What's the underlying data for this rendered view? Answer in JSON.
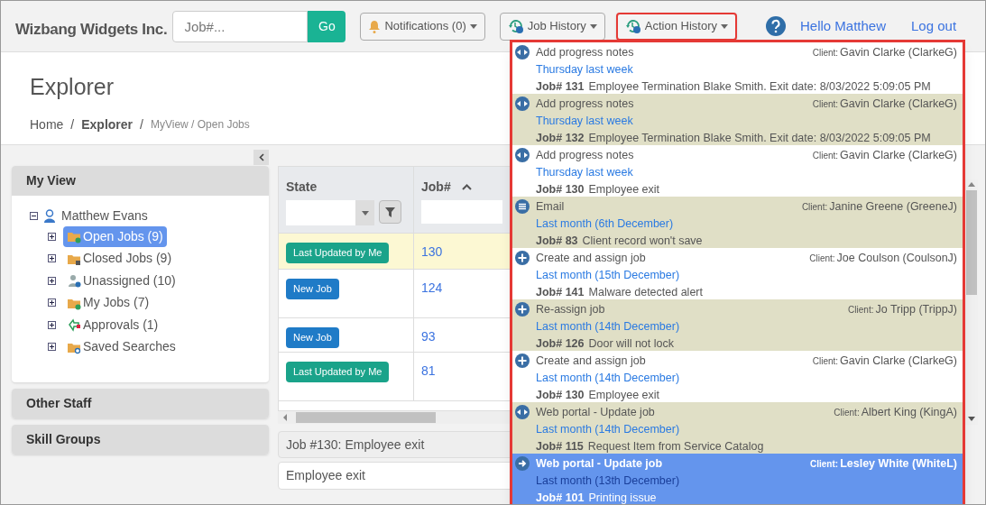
{
  "header": {
    "brand": "Wizbang Widgets Inc.",
    "search": {
      "placeholder": "Job#...",
      "button": "Go"
    },
    "notifications": "Notifications (0)",
    "job_history": "Job History",
    "action_history": {
      "label": "Action History",
      "expanded": true
    },
    "greeting": "Hello Matthew",
    "logout": "Log out"
  },
  "page": {
    "title": "Explorer",
    "breadcrumb": [
      "Home",
      "/",
      "Explorer",
      "/",
      "MyView / Open Jobs"
    ]
  },
  "sidebar": {
    "sections": [
      {
        "title": "My View",
        "tree": {
          "label": "Matthew Evans",
          "expanded": true,
          "children": [
            {
              "label": "Open Jobs (9)",
              "kind": "folder_user",
              "selected": true
            },
            {
              "label": "Closed Jobs (9)",
              "kind": "folder_closed",
              "selected": false
            },
            {
              "label": "Unassigned (10)",
              "kind": "user_question",
              "selected": false
            },
            {
              "label": "My Jobs (7)",
              "kind": "folder_user",
              "selected": false
            },
            {
              "label": "Approvals (1)",
              "kind": "approvals",
              "selected": false
            },
            {
              "label": "Saved Searches",
              "kind": "folder_search",
              "selected": false
            }
          ]
        }
      },
      {
        "title": "Other Staff"
      },
      {
        "title": "Skill Groups"
      }
    ]
  },
  "table": {
    "columns": [
      "State",
      "Job#"
    ],
    "rows": [
      {
        "state": "Last Updated by Me",
        "color": "#1aa38a",
        "job": "130",
        "selected": true
      },
      {
        "state": "New Job",
        "color": "#1f7bc7",
        "job": "124",
        "selected": false
      },
      {
        "state": "New Job",
        "color": "#1f7bc7",
        "job": "93",
        "selected": false
      },
      {
        "state": "Last Updated by Me",
        "color": "#1aa38a",
        "job": "81",
        "selected": false
      }
    ]
  },
  "detail": {
    "heading": "Job #130: Employee exit",
    "summary": "Employee exit"
  },
  "action_history_menu": [
    {
      "kind": "notes",
      "action": "Add progress notes",
      "client_label": "Client:",
      "client": "Gavin Clarke (ClarkeG)",
      "when": "Thursday last week",
      "job": "Job# 131",
      "text": "Employee Termination Blake Smith. Exit date: 8/03/2022 5:09:05 PM",
      "selected": false
    },
    {
      "kind": "notes",
      "action": "Add progress notes",
      "client_label": "Client:",
      "client": "Gavin Clarke (ClarkeG)",
      "when": "Thursday last week",
      "job": "Job# 132",
      "text": "Employee Termination Blake Smith. Exit date: 8/03/2022 5:09:05 PM",
      "selected": false
    },
    {
      "kind": "notes",
      "action": "Add progress notes",
      "client_label": "Client:",
      "client": "Gavin Clarke (ClarkeG)",
      "when": "Thursday last week",
      "job": "Job# 130",
      "text": "Employee exit",
      "selected": false
    },
    {
      "kind": "email",
      "action": "Email",
      "client_label": "Client:",
      "client": "Janine Greene (GreeneJ)",
      "when": "Last month (6th December)",
      "job": "Job# 83",
      "text": "Client record won't save",
      "selected": false
    },
    {
      "kind": "create",
      "action": "Create and assign job",
      "client_label": "Client:",
      "client": "Joe Coulson (CoulsonJ)",
      "when": "Last month (15th December)",
      "job": "Job# 141",
      "text": "Malware detected alert",
      "selected": false
    },
    {
      "kind": "create",
      "action": "Re-assign job",
      "client_label": "Client:",
      "client": "Jo Tripp (TrippJ)",
      "when": "Last month (14th December)",
      "job": "Job# 126",
      "text": "Door will not lock",
      "selected": false
    },
    {
      "kind": "create",
      "action": "Create and assign job",
      "client_label": "Client:",
      "client": "Gavin Clarke (ClarkeG)",
      "when": "Last month (14th December)",
      "job": "Job# 130",
      "text": "Employee exit",
      "selected": false
    },
    {
      "kind": "notes",
      "action": "Web portal - Update job",
      "client_label": "Client:",
      "client": "Albert King (KingA)",
      "when": "Last month (14th December)",
      "job": "Job# 115",
      "text": "Request Item from Service Catalog",
      "selected": false
    },
    {
      "kind": "notes",
      "action": "Web portal - Update job",
      "client_label": "Client:",
      "client": "Lesley White (WhiteL)",
      "when": "Last month (13th December)",
      "job": "Job# 101",
      "text": "Printing issue",
      "selected": true
    }
  ]
}
